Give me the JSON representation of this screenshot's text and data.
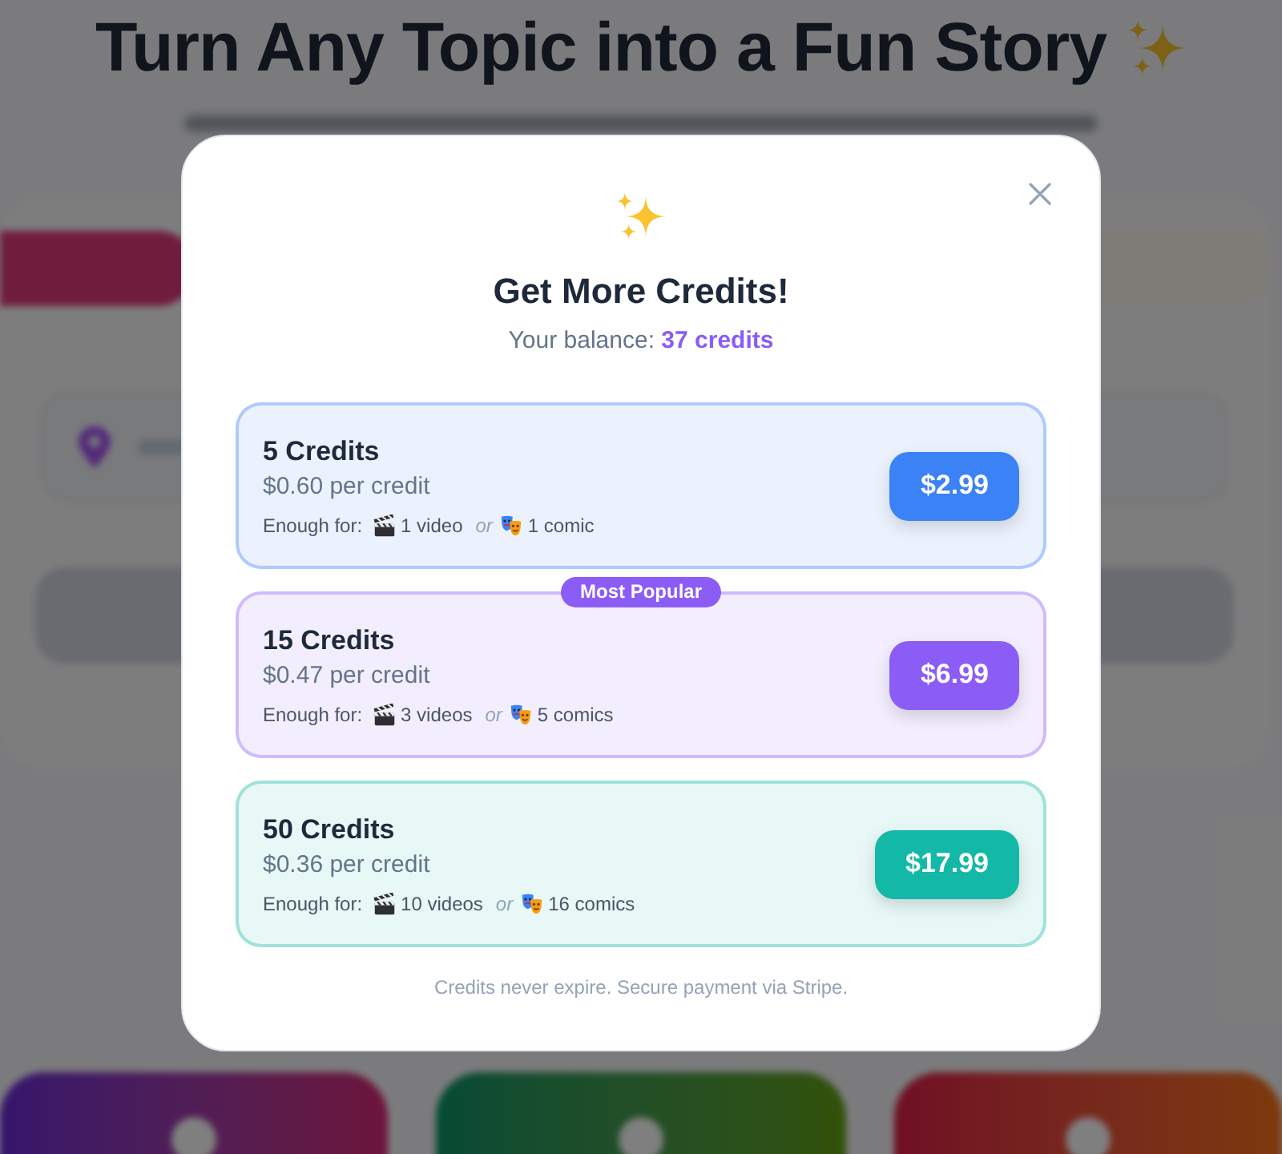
{
  "background": {
    "title": "Turn Any Topic into a Fun Story"
  },
  "dialog": {
    "title": "Get More Credits!",
    "balance": "Your balance: **37 credits**"
  },
  "packages": [
    {
      "name": "5 Credits",
      "per_credit": "$0.60 per credit",
      "enough_label": "Enough for:",
      "video": "1 video",
      "or": "or",
      "comic": "1 comic",
      "price": "$2.99",
      "color": "#3b82f6"
    },
    {
      "name": "15 Credits",
      "per_credit": "$0.47 per credit",
      "enough_label": "Enough for:",
      "video": "3 videos",
      "or": "or",
      "comic": "5 comics",
      "price": "$6.99",
      "color": "#8b5cf6",
      "badge": "Most Popular"
    },
    {
      "name": "50 Credits",
      "per_credit": "$0.36 per credit",
      "enough_label": "Enough for:",
      "video": "10 videos",
      "or": "or",
      "comic": "16 comics",
      "price": "$17.99",
      "color": "#14b8a6"
    }
  ],
  "footer": "Credits never expire. Secure payment via Stripe."
}
